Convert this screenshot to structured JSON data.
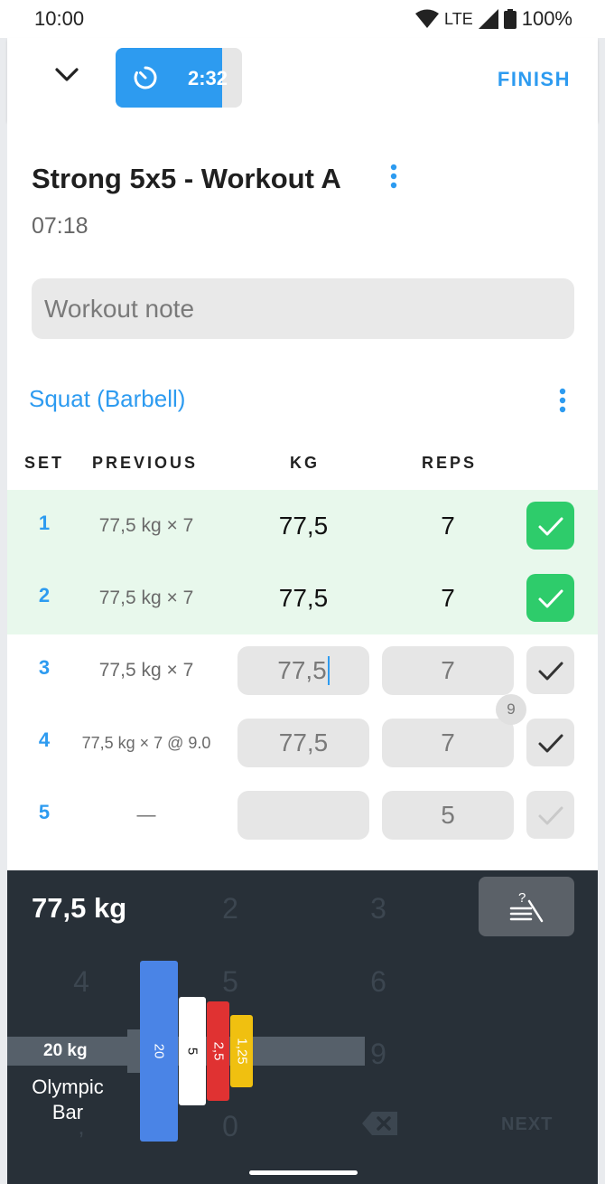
{
  "status": {
    "time": "10:00",
    "network": "LTE",
    "battery": "100%"
  },
  "appbar": {
    "timer": "2:32",
    "timer_progress": 0.84,
    "finish": "FINISH"
  },
  "workout": {
    "title": "Strong 5x5 - Workout A",
    "duration": "07:18",
    "note_placeholder": "Workout note"
  },
  "exercise": {
    "name": "Squat (Barbell)",
    "headers": {
      "set": "SET",
      "previous": "PREVIOUS",
      "kg": "KG",
      "reps": "REPS"
    },
    "sets": [
      {
        "num": "1",
        "previous": "77,5 kg × 7",
        "kg": "77,5",
        "reps": "7"
      },
      {
        "num": "2",
        "previous": "77,5 kg × 7",
        "kg": "77,5",
        "reps": "7"
      },
      {
        "num": "3",
        "previous": "77,5 kg × 7",
        "kg": "77,5",
        "reps": "7"
      },
      {
        "num": "4",
        "previous": "77,5 kg × 7 @ 9.0",
        "kg": "77,5",
        "reps": "7",
        "rpe": "9"
      },
      {
        "num": "5",
        "previous": "—",
        "kg": "",
        "reps": "5"
      }
    ]
  },
  "keyboard": {
    "value": "77,5 kg",
    "keys": {
      "k2": "2",
      "k3": "3",
      "k4": "4",
      "k5": "5",
      "k6": "6",
      "k9": "9",
      "k0": "0",
      "comma": ","
    },
    "next": "NEXT"
  },
  "barbell": {
    "bar_weight": "20 kg",
    "bar_name": "Olympic Bar",
    "plates": [
      "20",
      "5",
      "2,5",
      "1,25"
    ]
  },
  "colors": {
    "accent": "#2d9bf0",
    "done_green": "#2ecc6b",
    "done_row": "#e8f8ec",
    "keyboard_bg": "#283038"
  }
}
